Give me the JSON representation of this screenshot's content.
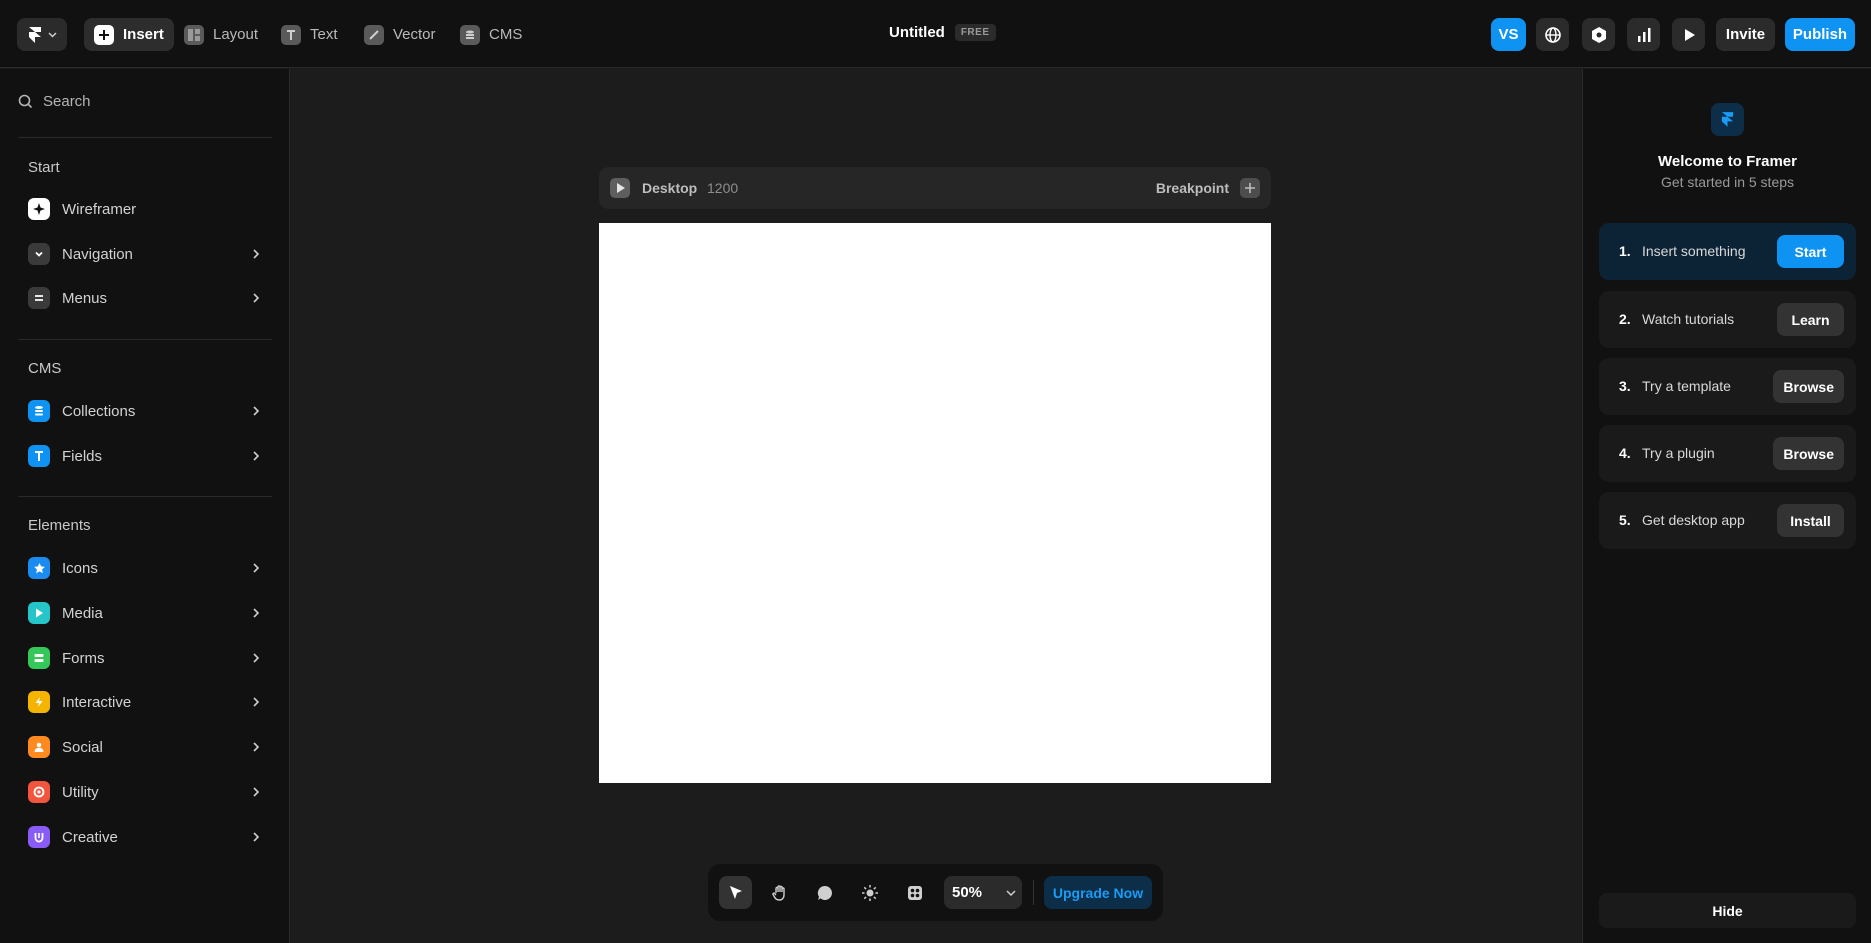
{
  "topbar": {
    "tools": [
      {
        "label": "Insert",
        "icon": "insert-icon",
        "active": true
      },
      {
        "label": "Layout",
        "icon": "layout-icon"
      },
      {
        "label": "Text",
        "icon": "text-icon"
      },
      {
        "label": "Vector",
        "icon": "vector-icon"
      },
      {
        "label": "CMS",
        "icon": "cms-icon"
      }
    ],
    "title": "Untitled",
    "plan_badge": "FREE",
    "avatar_initials": "VS",
    "invite_label": "Invite",
    "publish_label": "Publish"
  },
  "sidebar": {
    "search_placeholder": "Search",
    "sections": [
      {
        "title": "Start",
        "items": [
          {
            "label": "Wireframer",
            "color": "#ffffff",
            "icon": "sparkle-icon",
            "chevron": false
          },
          {
            "label": "Navigation",
            "color": "#3a3a3a",
            "icon": "chevron-down-icon",
            "chevron": true
          },
          {
            "label": "Menus",
            "color": "#3a3a3a",
            "icon": "menu-icon",
            "chevron": true
          }
        ]
      },
      {
        "title": "CMS",
        "items": [
          {
            "label": "Collections",
            "color": "#0f93f2",
            "icon": "database-icon",
            "chevron": true
          },
          {
            "label": "Fields",
            "color": "#0f93f2",
            "icon": "text-field-icon",
            "chevron": true
          }
        ]
      },
      {
        "title": "Elements",
        "items": [
          {
            "label": "Icons",
            "color": "#1a8cf0",
            "icon": "star-icon",
            "chevron": true
          },
          {
            "label": "Media",
            "color": "#25c5c9",
            "icon": "play-icon",
            "chevron": true
          },
          {
            "label": "Forms",
            "color": "#34c759",
            "icon": "form-icon",
            "chevron": true
          },
          {
            "label": "Interactive",
            "color": "#f5b400",
            "icon": "bolt-icon",
            "chevron": true
          },
          {
            "label": "Social",
            "color": "#ff8a1f",
            "icon": "person-icon",
            "chevron": true
          },
          {
            "label": "Utility",
            "color": "#f2553d",
            "icon": "lifebuoy-icon",
            "chevron": true
          },
          {
            "label": "Creative",
            "color": "#8a5cf6",
            "icon": "creative-icon",
            "chevron": true
          }
        ]
      }
    ]
  },
  "canvas": {
    "breakpoint_name": "Desktop",
    "breakpoint_width": "1200",
    "breakpoint_label": "Breakpoint"
  },
  "bottombar": {
    "zoom": "50%",
    "upgrade_label": "Upgrade Now"
  },
  "welcome": {
    "title": "Welcome to Framer",
    "subtitle": "Get started in 5 steps",
    "steps": [
      {
        "num": "1.",
        "label": "Insert something",
        "button": "Start",
        "active": true
      },
      {
        "num": "2.",
        "label": "Watch tutorials",
        "button": "Learn"
      },
      {
        "num": "3.",
        "label": "Try a template",
        "button": "Browse"
      },
      {
        "num": "4.",
        "label": "Try a plugin",
        "button": "Browse"
      },
      {
        "num": "5.",
        "label": "Get desktop app",
        "button": "Install"
      }
    ],
    "hide_label": "Hide"
  }
}
